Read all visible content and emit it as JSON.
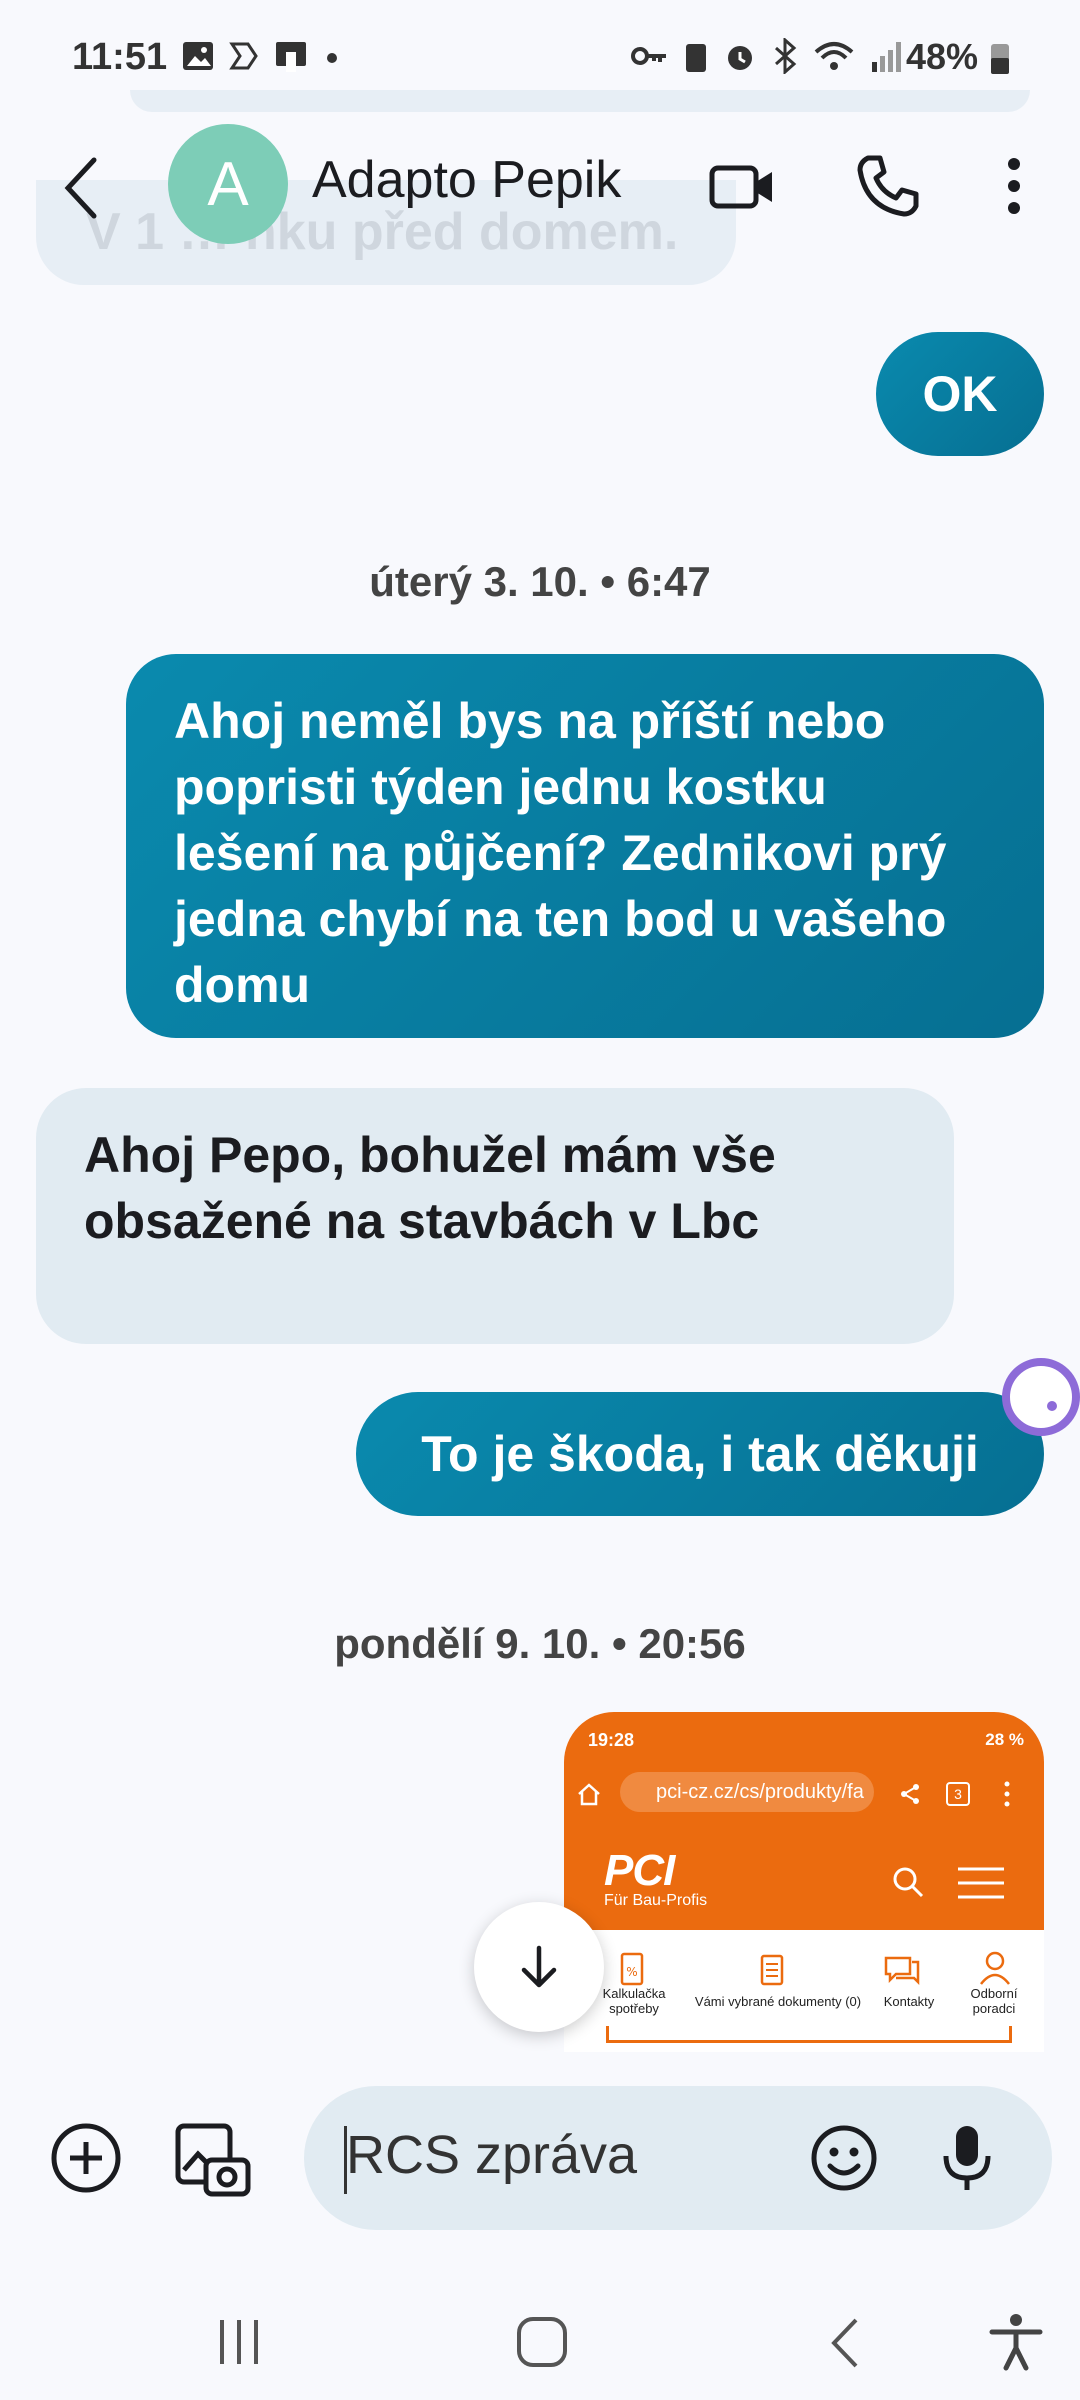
{
  "status_bar": {
    "time": "11:51",
    "battery": "48%"
  },
  "header": {
    "avatar_letter": "A",
    "contact_name": "Adapto Pepik"
  },
  "conversation": {
    "faded_message": "V 1 … nku před domem.",
    "messages": [
      {
        "dir": "out",
        "text": "OK"
      },
      {
        "dir": "ts",
        "text": "úterý 3. 10. • 6:47"
      },
      {
        "dir": "out",
        "lines": [
          "Ahoj neměl bys na příští nebo",
          "popristi týden jednu kostku",
          "lešení na půjčení?  Zednikovi prý",
          "jedna chybí na ten bod u vašeho",
          "domu"
        ]
      },
      {
        "dir": "in",
        "lines": [
          "Ahoj Pepo, bohužel mám vše",
          "obsažené na stavbách v Lbc"
        ]
      },
      {
        "dir": "out",
        "text": "To je škoda, i tak děkuji"
      },
      {
        "dir": "ts",
        "text": "pondělí 9. 10. • 20:56"
      }
    ]
  },
  "preview": {
    "time": "19:28",
    "status": "28 %",
    "url": "pci-cz.cz/cs/produkty/fa",
    "tab_count": "3",
    "logo": "PCI",
    "logo_sub": "Für Bau-Profis",
    "nav_items": [
      "Kalkulačka spotřeby",
      "Vámi vybrané dokumenty (0)",
      "Kontakty",
      "Odborní poradci"
    ]
  },
  "composer": {
    "placeholder": "RCS zpráva"
  },
  "colors": {
    "outgoing": "#0a8aae",
    "incoming": "#e1ebf2",
    "avatar": "#7dcdb7",
    "pci_orange": "#eb6b0f"
  }
}
